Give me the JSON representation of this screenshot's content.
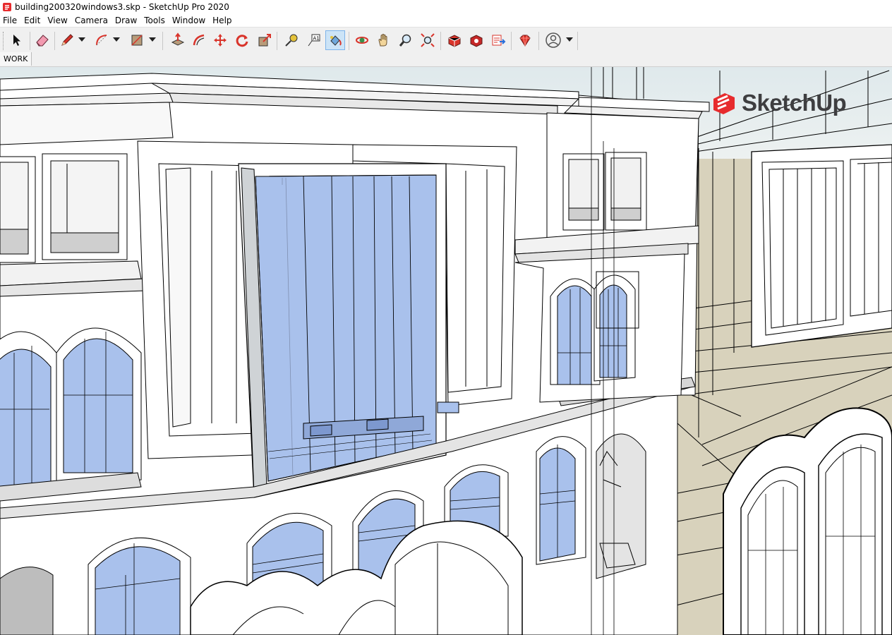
{
  "window": {
    "title": "building200320windows3.skp - SketchUp Pro 2020"
  },
  "menu": [
    "File",
    "Edit",
    "View",
    "Camera",
    "Draw",
    "Tools",
    "Window",
    "Help"
  ],
  "toolbar": {
    "tools": [
      {
        "name": "select-tool",
        "icon": "cursor-arrow-icon"
      },
      {
        "name": "eraser-tool",
        "icon": "eraser-icon"
      },
      {
        "name": "line-tool",
        "icon": "pencil-icon"
      },
      {
        "name": "arc-tool",
        "icon": "arc-icon"
      },
      {
        "name": "rectangle-tool",
        "icon": "rectangle-icon"
      },
      {
        "name": "push-pull-tool",
        "icon": "push-pull-icon"
      },
      {
        "name": "offset-tool",
        "icon": "offset-icon"
      },
      {
        "name": "move-tool",
        "icon": "move-icon"
      },
      {
        "name": "rotate-tool",
        "icon": "rotate-icon"
      },
      {
        "name": "scale-tool",
        "icon": "scale-icon"
      },
      {
        "name": "tape-measure-tool",
        "icon": "tape-measure-icon"
      },
      {
        "name": "text-tool",
        "icon": "text-icon"
      },
      {
        "name": "paint-bucket-tool",
        "icon": "paint-bucket-icon",
        "active": true
      },
      {
        "name": "orbit-tool",
        "icon": "orbit-icon"
      },
      {
        "name": "pan-tool",
        "icon": "hand-icon"
      },
      {
        "name": "zoom-tool",
        "icon": "magnifier-icon"
      },
      {
        "name": "zoom-extents-tool",
        "icon": "zoom-extents-icon"
      },
      {
        "name": "3d-warehouse-button",
        "icon": "warehouse-icon"
      },
      {
        "name": "extension-warehouse-button",
        "icon": "extension-icon"
      },
      {
        "name": "send-to-layout-button",
        "icon": "layout-icon"
      },
      {
        "name": "ruby-console-button",
        "icon": "ruby-icon"
      },
      {
        "name": "account-button",
        "icon": "user-circle-icon"
      }
    ],
    "accent": "#cce4f7"
  },
  "scenes": {
    "tabs": [
      {
        "label": "WORK"
      }
    ]
  },
  "logo": {
    "text": "SketchUp",
    "color": "#e72b2d"
  },
  "viewport": {
    "sky_color": "#dce8ec",
    "ground_color": "#d8d2bc",
    "glass_color": "#a9c1ec",
    "face_color": "#ffffff",
    "edge_color": "#000000"
  }
}
